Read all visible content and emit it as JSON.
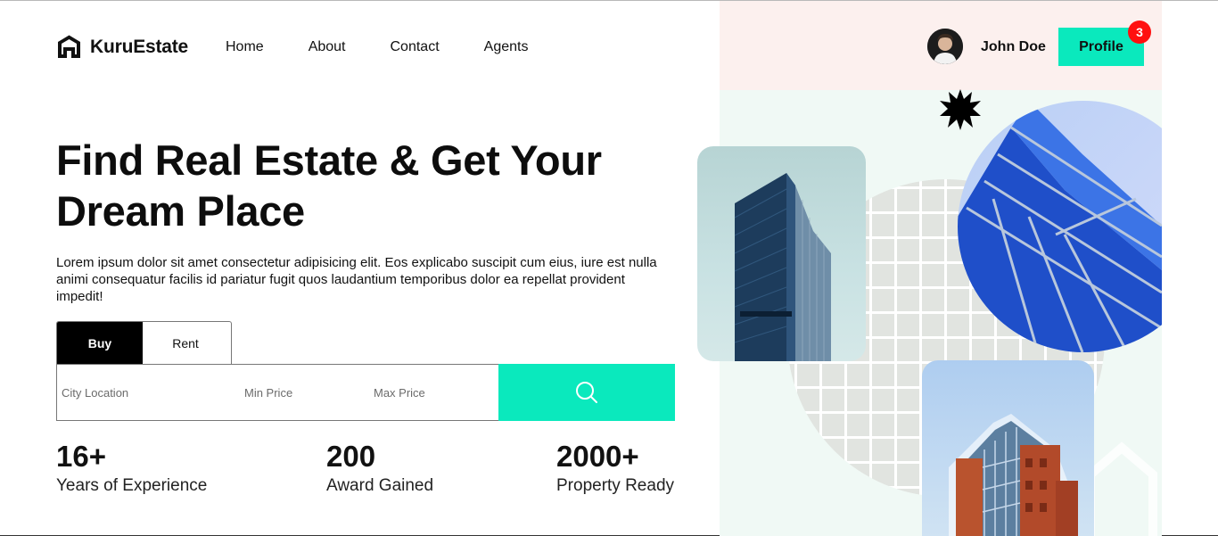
{
  "brand": {
    "name": "KuruEstate",
    "logo_icon": "house-logo-icon"
  },
  "nav": {
    "items": [
      "Home",
      "About",
      "Contact",
      "Agents"
    ]
  },
  "user": {
    "name": "John Doe",
    "profile_label": "Profile",
    "notification_count": "3"
  },
  "hero": {
    "title_line1": "Find Real Estate & Get Your",
    "title_line2": "Dream Place",
    "description": "Lorem ipsum dolor sit amet consectetur adipisicing elit. Eos explicabo suscipit cum eius, iure est nulla animi consequatur facilis id pariatur fugit quos laudantium temporibus dolor ea repellat provident impedit!"
  },
  "search": {
    "tabs": [
      {
        "label": "Buy",
        "active": true
      },
      {
        "label": "Rent",
        "active": false
      }
    ],
    "city_placeholder": "City Location",
    "min_price_placeholder": "Min Price",
    "max_price_placeholder": "Max Price",
    "button_icon": "search-icon"
  },
  "stats": [
    {
      "value": "16+",
      "label": "Years of Experience"
    },
    {
      "value": "200",
      "label": "Award Gained"
    },
    {
      "value": "2000+",
      "label": "Property Ready"
    }
  ],
  "colors": {
    "accent": "#0ae9bd",
    "badge": "#ff1010",
    "panel_top": "#fcf0ee",
    "panel_bottom": "#f0f9f5"
  }
}
